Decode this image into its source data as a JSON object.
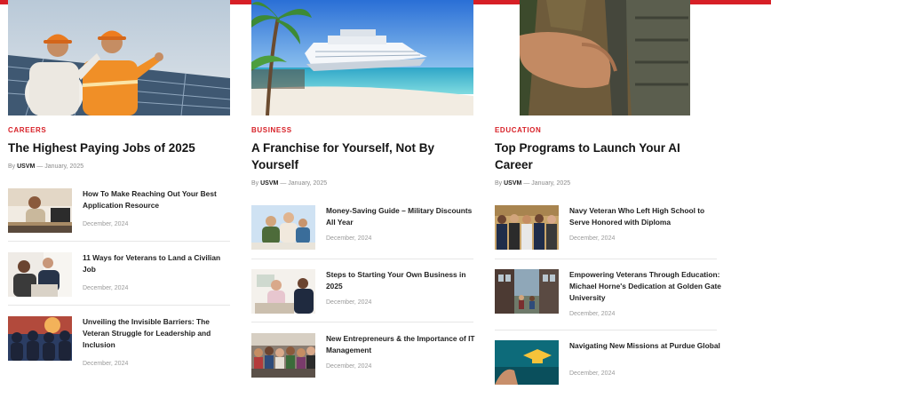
{
  "byline": {
    "prefix": "By",
    "author": "USVM",
    "dash": "—",
    "date": "January, 2025"
  },
  "columns": [
    {
      "category": "CAREERS",
      "title": "The Highest Paying Jobs of 2025",
      "items": [
        {
          "title": "How To Make Reaching Out Your Best Application Resource",
          "date": "December, 2024"
        },
        {
          "title": "11 Ways for Veterans to Land a Civilian Job",
          "date": "December, 2024"
        },
        {
          "title": "Unveiling the Invisible Barriers: The Veteran Struggle for Leadership and Inclusion",
          "date": "December, 2024"
        }
      ]
    },
    {
      "category": "BUSINESS",
      "title": "A Franchise for Yourself, Not By Yourself",
      "items": [
        {
          "title": "Money-Saving Guide – Military Discounts All Year",
          "date": "December, 2024"
        },
        {
          "title": "Steps to Starting Your Own Business in 2025",
          "date": "December, 2024"
        },
        {
          "title": "New Entrepreneurs & the Importance of IT Management",
          "date": "December, 2024"
        }
      ]
    },
    {
      "category": "EDUCATION",
      "title": "Top Programs to Launch Your AI Career",
      "items": [
        {
          "title": "Navy Veteran Who Left High School to Serve Honored with Diploma",
          "date": "December, 2024"
        },
        {
          "title": "Empowering Veterans Through Education: Michael Horne's Dedication at Golden Gate University",
          "date": "December, 2024"
        },
        {
          "title": "Navigating New Missions at Purdue Global",
          "date": "December, 2024"
        }
      ]
    }
  ]
}
